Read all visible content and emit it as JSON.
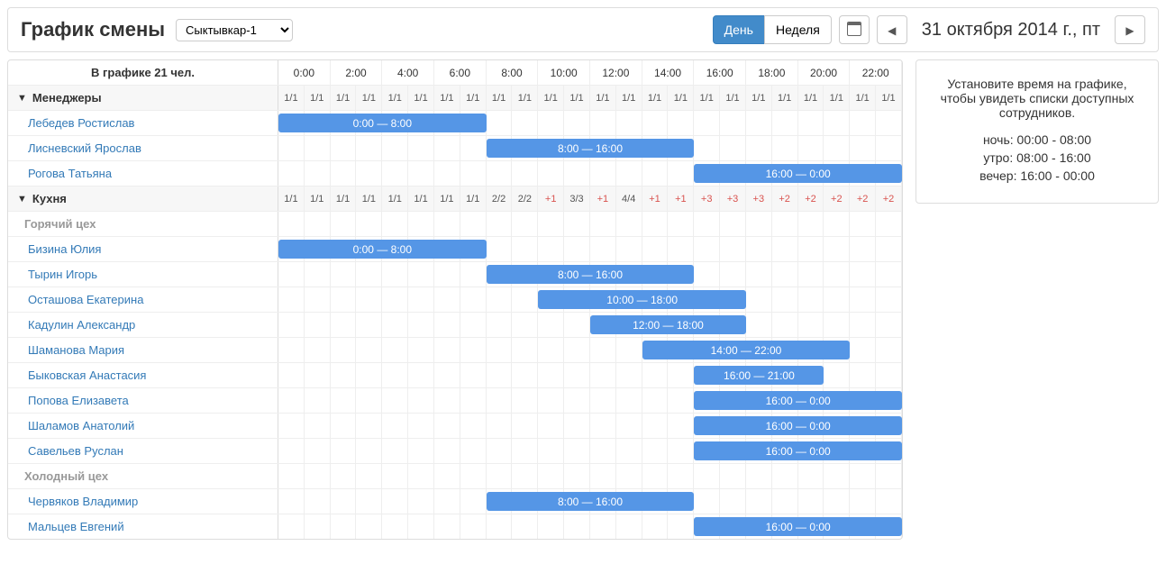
{
  "header": {
    "title": "График смены",
    "selector_options": [
      "Сыктывкар-1"
    ],
    "selector_value": "Сыктывкар-1",
    "view_day": "День",
    "view_week": "Неделя",
    "date": "31 октября 2014 г., пт"
  },
  "sidebar": {
    "hint": "Установите время на графике, чтобы увидеть списки доступных сотрудников.",
    "slots": [
      "ночь: 00:00 - 08:00",
      "утро: 08:00 - 16:00",
      "вечер: 16:00 - 00:00"
    ]
  },
  "schedule": {
    "count_label": "В графике 21 чел.",
    "hours": [
      "0:00",
      "2:00",
      "4:00",
      "6:00",
      "8:00",
      "10:00",
      "12:00",
      "14:00",
      "16:00",
      "18:00",
      "20:00",
      "22:00"
    ],
    "groups": [
      {
        "name": "Менеджеры",
        "slots": [
          "1/1",
          "1/1",
          "1/1",
          "1/1",
          "1/1",
          "1/1",
          "1/1",
          "1/1",
          "1/1",
          "1/1",
          "1/1",
          "1/1",
          "1/1",
          "1/1",
          "1/1",
          "1/1",
          "1/1",
          "1/1",
          "1/1",
          "1/1",
          "1/1",
          "1/1",
          "1/1",
          "1/1"
        ],
        "slot_colors": [
          "black",
          "black",
          "black",
          "black",
          "black",
          "black",
          "black",
          "black",
          "black",
          "black",
          "black",
          "black",
          "black",
          "black",
          "black",
          "black",
          "black",
          "black",
          "black",
          "black",
          "black",
          "black",
          "black",
          "black"
        ],
        "people": [
          {
            "name": "Лебедев Ростислав",
            "shift": {
              "start": 0,
              "end": 8,
              "label": "0:00 — 8:00"
            }
          },
          {
            "name": "Лисневский Ярослав",
            "shift": {
              "start": 8,
              "end": 16,
              "label": "8:00 — 16:00"
            }
          },
          {
            "name": "Рогова Татьяна",
            "shift": {
              "start": 16,
              "end": 24,
              "label": "16:00 — 0:00"
            }
          }
        ]
      },
      {
        "name": "Кухня",
        "slots": [
          "1/1",
          "1/1",
          "1/1",
          "1/1",
          "1/1",
          "1/1",
          "1/1",
          "1/1",
          "2/2",
          "2/2",
          "+1",
          "3/3",
          "+1",
          "4/4",
          "+1",
          "+1",
          "+3",
          "+3",
          "+3",
          "+2",
          "+2",
          "+2",
          "+2",
          "+2"
        ],
        "slot_colors": [
          "black",
          "black",
          "black",
          "black",
          "black",
          "black",
          "black",
          "black",
          "black",
          "black",
          "red",
          "black",
          "red",
          "black",
          "red",
          "red",
          "red",
          "red",
          "red",
          "red",
          "red",
          "red",
          "red",
          "red"
        ],
        "subgroups": [
          {
            "name": "Горячий цех",
            "people": [
              {
                "name": "Бизина Юлия",
                "shift": {
                  "start": 0,
                  "end": 8,
                  "label": "0:00 — 8:00"
                }
              },
              {
                "name": "Тырин Игорь",
                "shift": {
                  "start": 8,
                  "end": 16,
                  "label": "8:00 — 16:00"
                }
              },
              {
                "name": "Осташова Екатерина",
                "shift": {
                  "start": 10,
                  "end": 18,
                  "label": "10:00 — 18:00"
                }
              },
              {
                "name": "Кадулин Александр",
                "shift": {
                  "start": 12,
                  "end": 18,
                  "label": "12:00 — 18:00"
                }
              },
              {
                "name": "Шаманова Мария",
                "shift": {
                  "start": 14,
                  "end": 22,
                  "label": "14:00 — 22:00"
                }
              },
              {
                "name": "Быковская Анастасия",
                "shift": {
                  "start": 16,
                  "end": 21,
                  "label": "16:00 — 21:00"
                }
              },
              {
                "name": "Попова Елизавета",
                "shift": {
                  "start": 16,
                  "end": 24,
                  "label": "16:00 — 0:00"
                }
              },
              {
                "name": "Шаламов Анатолий",
                "shift": {
                  "start": 16,
                  "end": 24,
                  "label": "16:00 — 0:00"
                }
              },
              {
                "name": "Савельев Руслан",
                "shift": {
                  "start": 16,
                  "end": 24,
                  "label": "16:00 — 0:00"
                }
              }
            ]
          },
          {
            "name": "Холодный цех",
            "people": [
              {
                "name": "Червяков Владимир",
                "shift": {
                  "start": 8,
                  "end": 16,
                  "label": "8:00 — 16:00"
                }
              },
              {
                "name": "Мальцев Евгений",
                "shift": {
                  "start": 16,
                  "end": 24,
                  "label": "16:00 — 0:00"
                }
              }
            ]
          }
        ]
      }
    ]
  }
}
